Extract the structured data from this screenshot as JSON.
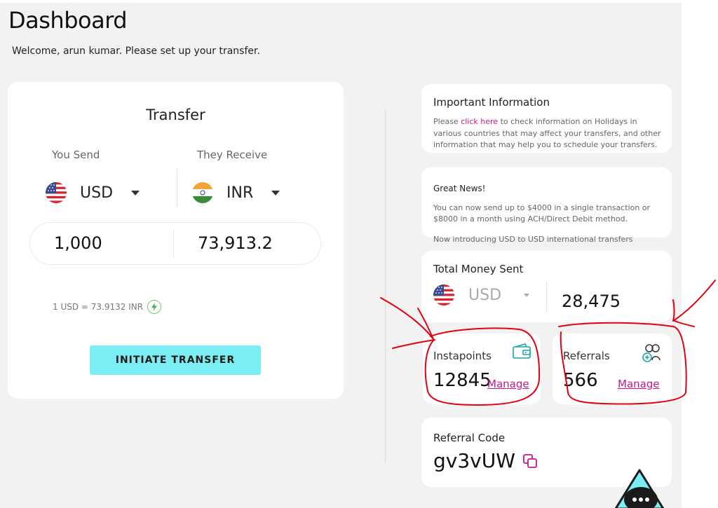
{
  "header": {
    "title": "Dashboard",
    "welcome": "Welcome, arun kumar. Please set up your transfer."
  },
  "transfer": {
    "title": "Transfer",
    "you_send_label": "You Send",
    "they_receive_label": "They Receive",
    "send_currency": "USD",
    "receive_currency": "INR",
    "send_amount": "1,000",
    "receive_amount": "73,913.2",
    "rate": "1 USD = 73.9132 INR",
    "initiate_label": "INITIATE TRANSFER"
  },
  "important_info": {
    "title": "Important Information",
    "text_before": "Please ",
    "link": "click here",
    "text_after": " to check information on Holidays in various countries that may affect your transfers, and other information that may help you to schedule your transfers."
  },
  "news": {
    "title": "Great News!",
    "text": "You can now send up to $4000 in a single transaction or $8000 in a month using ACH/Direct Debit method.",
    "extra": "Now introducing USD to USD international transfers"
  },
  "total_money": {
    "title": "Total Money Sent",
    "currency": "USD",
    "value": "28,475"
  },
  "instapoints": {
    "label": "Instapoints",
    "value": "12845",
    "link": "Manage"
  },
  "referrals": {
    "label": "Referrals",
    "value": "566",
    "link": "Manage"
  },
  "referral_code": {
    "title": "Referral Code",
    "value": "gv3vUW"
  },
  "colors": {
    "accent_pink": "#c8168c",
    "button_cyan": "#7aeef2",
    "annotation_red": "#e3000f",
    "background": "#f2f2f2"
  },
  "icons": [
    "us-flag-icon",
    "india-flag-icon",
    "caret-down-icon",
    "rate-lightning-icon",
    "wallet-icon",
    "add-user-icon",
    "copy-icon",
    "chatbot-icon"
  ]
}
